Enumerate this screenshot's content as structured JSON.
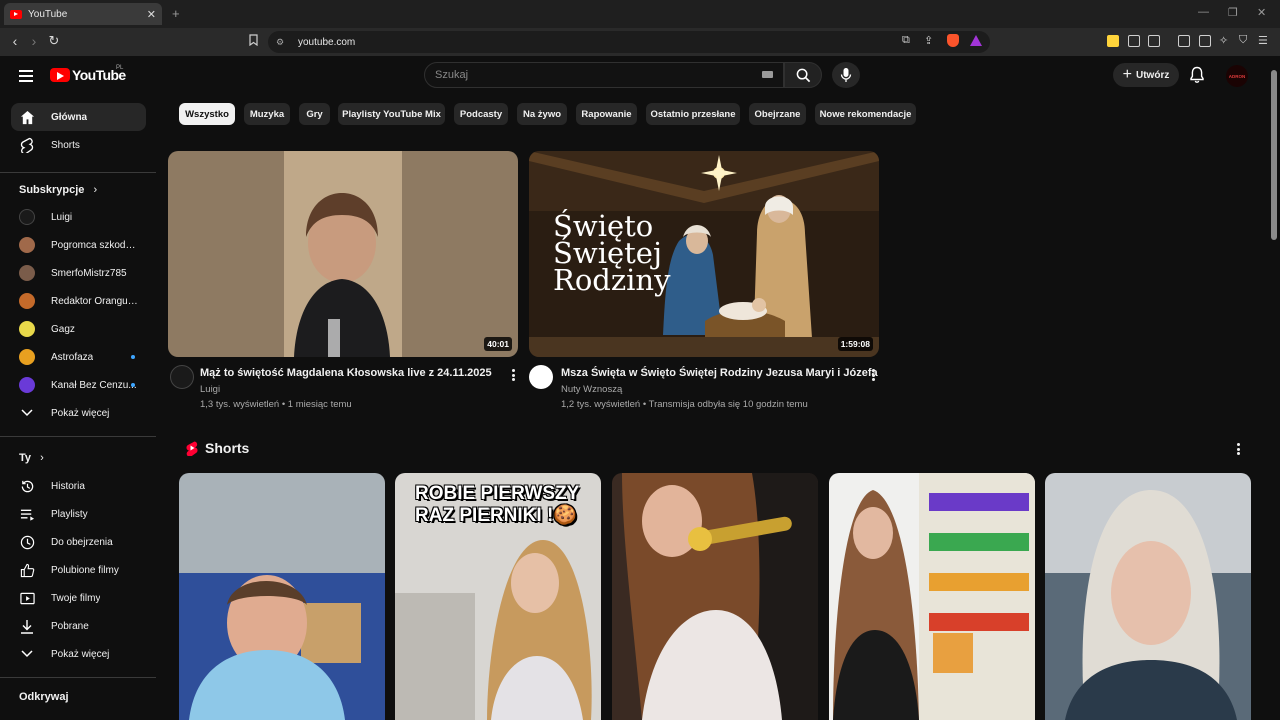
{
  "browser": {
    "tab_title": "YouTube",
    "url": "youtube.com"
  },
  "header": {
    "logo_text": "YouTube",
    "country": "PL",
    "search_placeholder": "Szukaj",
    "create_label": "Utwórz",
    "avatar_text": "ADRON"
  },
  "chips": [
    "Wszystko",
    "Muzyka",
    "Gry",
    "Playlisty YouTube Mix",
    "Podcasty",
    "Na żywo",
    "Rapowanie",
    "Ostatnio przesłane",
    "Obejrzane",
    "Nowe rekomendacje"
  ],
  "sidebar": {
    "main": [
      {
        "label": "Główna",
        "icon": "home-icon"
      },
      {
        "label": "Shorts",
        "icon": "shorts-icon"
      }
    ],
    "subscriptions_title": "Subskrypcje",
    "subscriptions": [
      {
        "label": "Luigi",
        "color": "#222222"
      },
      {
        "label": "Pogromca szkodni...",
        "color": "#a0694a"
      },
      {
        "label": "SmerfoMistrz785",
        "color": "#7a5c4a"
      },
      {
        "label": "Redaktor Orangutan",
        "color": "#c46a2a"
      },
      {
        "label": "Gagz",
        "color": "#e8d84a"
      },
      {
        "label": "Astrofaza",
        "color": "#e8a020"
      },
      {
        "label": "Kanał Bez Cenzu...",
        "color": "#6a3ad8"
      }
    ],
    "subscriptions_more": "Pokaż więcej",
    "you_title": "Ty",
    "you": [
      {
        "label": "Historia",
        "icon": "history-icon"
      },
      {
        "label": "Playlisty",
        "icon": "playlist-icon"
      },
      {
        "label": "Do obejrzenia",
        "icon": "clock-icon"
      },
      {
        "label": "Polubione filmy",
        "icon": "thumbs-up-icon"
      },
      {
        "label": "Twoje filmy",
        "icon": "video-icon"
      },
      {
        "label": "Pobrane",
        "icon": "download-icon"
      }
    ],
    "you_more": "Pokaż więcej",
    "explore_title": "Odkrywaj"
  },
  "videos": [
    {
      "title": "Mąż to świętość Magdalena Kłosowska live z 24.11.2025",
      "channel": "Luigi",
      "meta": "1,3 tys. wyświetleń • 1 miesiąc temu",
      "duration": "40:01"
    },
    {
      "title": "Msza Święta w Święto Świętej Rodziny Jezusa Maryi i Józefa",
      "channel": "Nuty Wznoszą",
      "meta": "1,2 tys. wyświetleń • Transmisja odbyła się 10 godzin temu",
      "duration": "1:59:08",
      "thumb_text": [
        "Święto",
        "Świętej",
        "Rodziny"
      ]
    }
  ],
  "shorts": {
    "title": "Shorts",
    "items": [
      {
        "overlay": ""
      },
      {
        "overlay_line1": "ROBIE PIERWSZY",
        "overlay_line2": "RAZ PIERNIKI !🍪"
      },
      {
        "overlay": ""
      },
      {
        "overlay": ""
      },
      {
        "overlay": ""
      }
    ]
  },
  "colors": {
    "background": "#0f0f0f",
    "chip": "#272727",
    "brand_red": "#ff0000",
    "link_blue": "#3ea6ff"
  }
}
